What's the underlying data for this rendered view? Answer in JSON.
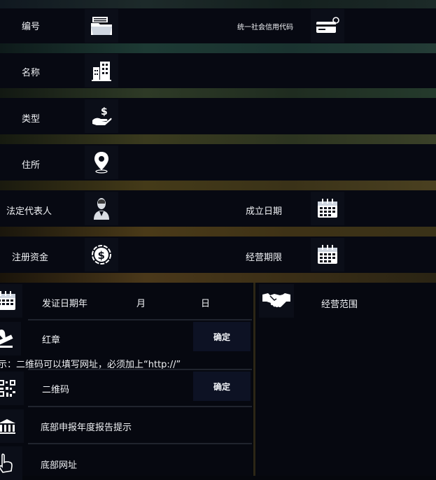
{
  "fields": {
    "number": {
      "label": "编号",
      "icon": "folder-icon"
    },
    "credit_code": {
      "label": "统一社会信用代码",
      "icon": "credit-card-icon"
    },
    "name": {
      "label": "名称",
      "icon": "building-icon"
    },
    "type": {
      "label": "类型",
      "icon": "money-hand-icon"
    },
    "address": {
      "label": "住所",
      "icon": "location-pin-icon"
    },
    "legal_rep": {
      "label": "法定代表人",
      "icon": "person-icon"
    },
    "found_date": {
      "label": "成立日期",
      "icon": "calendar-icon"
    },
    "capital": {
      "label": "注册资金",
      "icon": "dollar-coin-icon"
    },
    "term": {
      "label": "经营期限",
      "icon": "calendar-icon"
    }
  },
  "issue": {
    "label": "发证日期年",
    "month_label": "月",
    "day_label": "日"
  },
  "scope": {
    "label": "经营范围",
    "icon": "handshake-icon"
  },
  "red_seal": {
    "label": "红章",
    "confirm": "确定"
  },
  "hint": "示：二维码可以填写网址，必须加上“http://”",
  "qr": {
    "label": "二维码",
    "confirm": "确定"
  },
  "footer_hint": {
    "label": "底部申报年度报告提示"
  },
  "footer_url": {
    "label": "底部网址"
  },
  "colors": {
    "background": "#05070d",
    "row": "#070912",
    "button": "#0d1224",
    "band_teal": "#1b3a34",
    "band_olive": "#3a3418",
    "band_gold": "#4a3a1a"
  }
}
